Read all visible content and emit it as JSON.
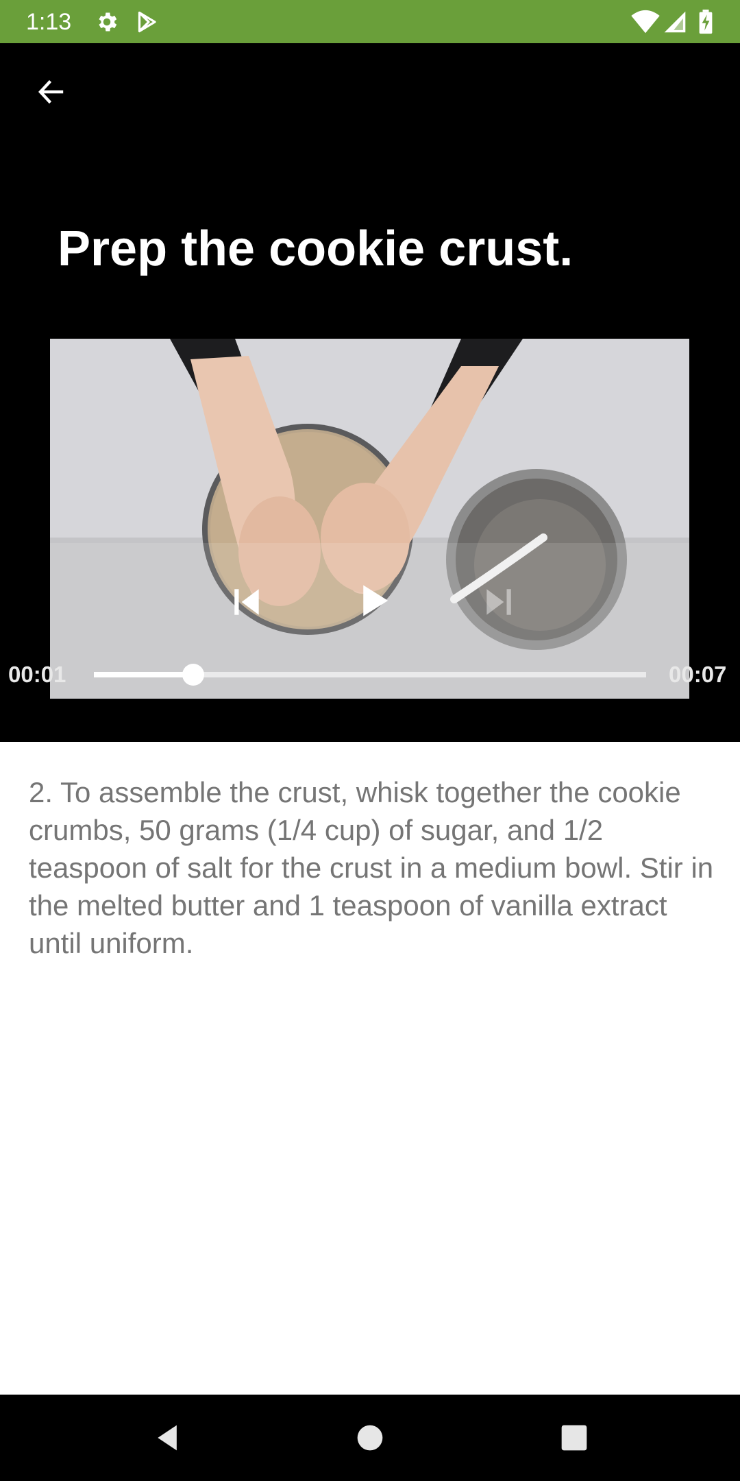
{
  "status_bar": {
    "time": "1:13",
    "icons": [
      "gear-icon",
      "play-store-icon",
      "wifi-icon",
      "signal-icon",
      "battery-charging-icon"
    ],
    "color": "#6a9f3a"
  },
  "header": {
    "back_icon": "arrow-left-icon",
    "title": "Prep the cookie crust."
  },
  "video": {
    "current_time": "00:01",
    "duration": "00:07",
    "progress": 0.18,
    "controls": [
      "previous-icon",
      "play-icon",
      "next-icon"
    ],
    "next_enabled": false
  },
  "instruction": {
    "text": "2. To assemble the crust, whisk together the cookie crumbs, 50 grams (1/4 cup) of sugar, and 1/2 teaspoon of salt for the crust in a medium bowl. Stir in the melted butter and 1 teaspoon of vanilla extract until uniform."
  },
  "nav_bar": {
    "icons": [
      "back-triangle-icon",
      "home-circle-icon",
      "recents-square-icon"
    ]
  }
}
